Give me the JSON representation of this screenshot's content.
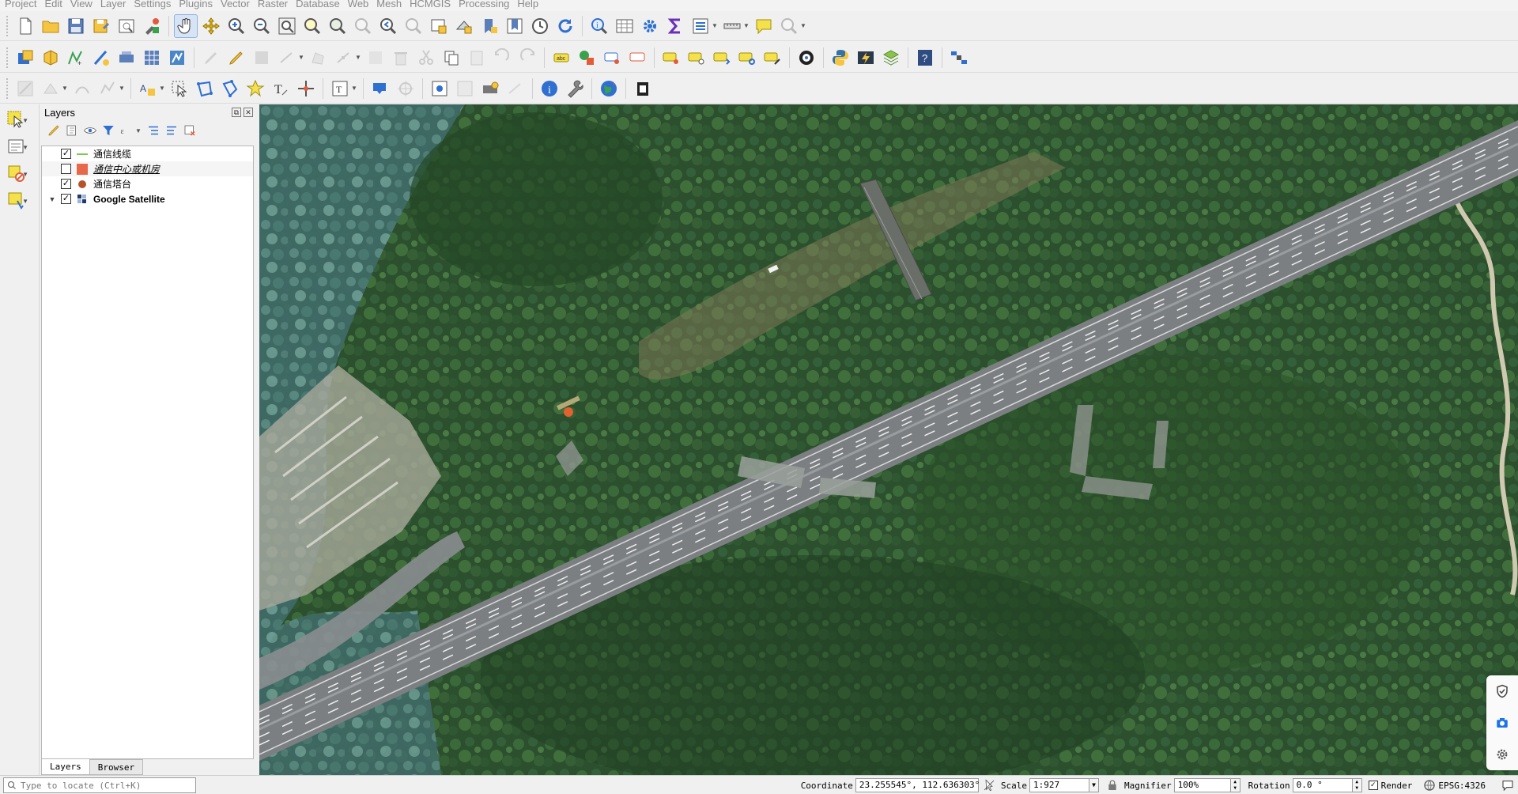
{
  "menu": [
    "Project",
    "Edit",
    "View",
    "Layer",
    "Settings",
    "Plugins",
    "Vector",
    "Raster",
    "Database",
    "Web",
    "Mesh",
    "HCMGIS",
    "Processing",
    "Help"
  ],
  "layers_panel": {
    "title": "Layers",
    "layers": [
      {
        "name": "通信线缆",
        "checked": true,
        "symbol": "line",
        "color": "#7ec850",
        "style": "normal"
      },
      {
        "name": "通信中心或机房",
        "checked": false,
        "symbol": "fill",
        "color": "#e8674a",
        "style": "italic"
      },
      {
        "name": "通信塔台",
        "checked": true,
        "symbol": "point",
        "color": "#b5542a",
        "style": "normal"
      },
      {
        "name": "Google Satellite",
        "checked": true,
        "symbol": "raster",
        "color": "#1f3b6e",
        "style": "bold",
        "expandable": true
      }
    ],
    "tabs": [
      "Layers",
      "Browser"
    ],
    "active_tab": "Layers"
  },
  "locator": {
    "placeholder": "Type to locate (Ctrl+K)"
  },
  "status": {
    "coordinate_label": "Coordinate",
    "coordinate_value": "23.255545°, 112.636303°",
    "scale_label": "Scale",
    "scale_value": "1:927",
    "magnifier_label": "Magnifier",
    "magnifier_value": "100%",
    "rotation_label": "Rotation",
    "rotation_value": "0.0 °",
    "render_label": "Render",
    "render_checked": true,
    "crs": "EPSG:4326"
  },
  "colors": {
    "accent": "#1a73e8",
    "tower_point": "#e0622f"
  }
}
